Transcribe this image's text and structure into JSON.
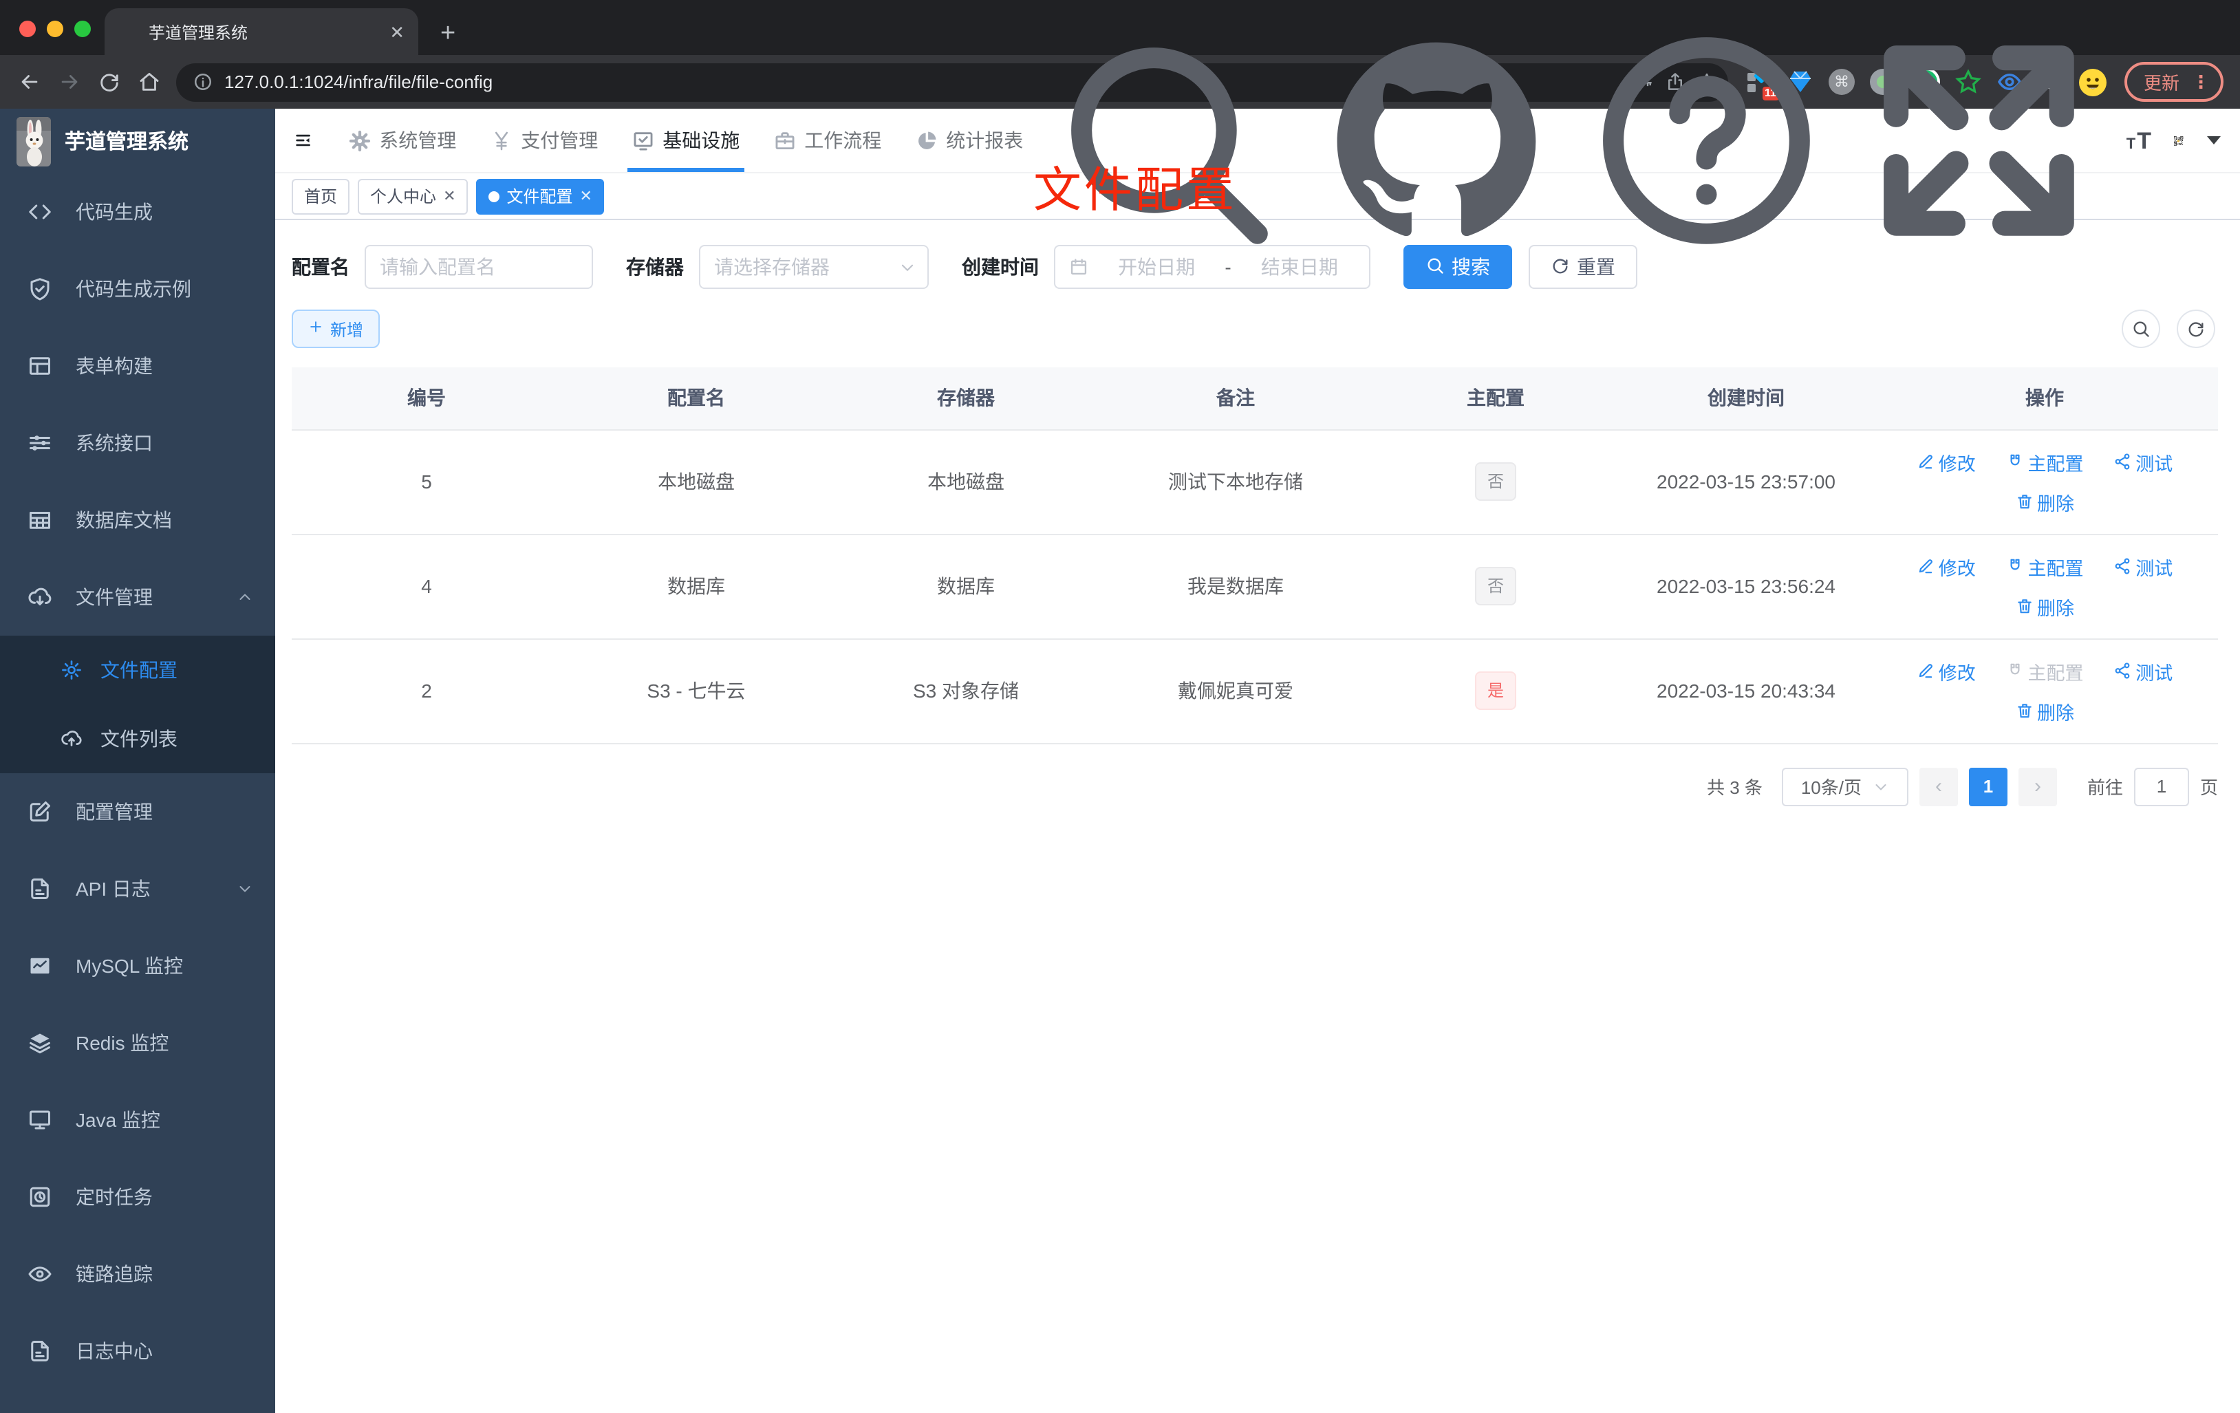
{
  "browser": {
    "tab_title": "芋道管理系统",
    "favicon": "sprout-icon",
    "url": "127.0.0.1:1024/infra/file/file-config",
    "url_left_icon": "info-icon",
    "url_right_icons": [
      "key-icon",
      "share-ios-icon",
      "star-icon"
    ],
    "nav_icons": [
      "back-icon",
      "forward-icon",
      "reload-icon",
      "home-icon"
    ],
    "extensions": [
      "tampermonkey-icon",
      "gem-icon",
      "cmd-circle-icon",
      "dot-circle-icon",
      "y-circle-icon",
      "green-star-icon",
      "blue-eye-icon",
      "puzzle-icon",
      "emoji-icon"
    ],
    "extension_badge": "11",
    "update_label": "更新"
  },
  "app": {
    "logo_title": "芋道管理系统",
    "accent_color": "#2d8cf0",
    "sidebar_color": "#304156"
  },
  "nav": {
    "items": [
      {
        "label": "系统管理",
        "icon": "gear-filled-icon",
        "active": false
      },
      {
        "label": "支付管理",
        "icon": "yen-icon",
        "active": false
      },
      {
        "label": "基础设施",
        "icon": "infra-icon",
        "active": true
      },
      {
        "label": "工作流程",
        "icon": "briefcase-icon",
        "active": false
      },
      {
        "label": "统计报表",
        "icon": "pie-icon",
        "active": false
      }
    ],
    "right_icons": [
      "search-icon",
      "github-icon",
      "question-icon",
      "fullscreen-icon",
      "fontsize-icon"
    ]
  },
  "sidebar": {
    "items": [
      {
        "label": "代码生成",
        "icon": "code-icon"
      },
      {
        "label": "代码生成示例",
        "icon": "shield-check-icon"
      },
      {
        "label": "表单构建",
        "icon": "form-icon"
      },
      {
        "label": "系统接口",
        "icon": "sliders-icon"
      },
      {
        "label": "数据库文档",
        "icon": "table-icon"
      },
      {
        "label": "文件管理",
        "icon": "cloud-download-icon",
        "expanded": true,
        "children": [
          {
            "label": "文件配置",
            "icon": "gear-icon",
            "active": true
          },
          {
            "label": "文件列表",
            "icon": "cloud-upload-icon",
            "active": false
          }
        ]
      },
      {
        "label": "配置管理",
        "icon": "edit-square-icon"
      },
      {
        "label": "API 日志",
        "icon": "log-icon",
        "collapsed": true
      },
      {
        "label": "MySQL 监控",
        "icon": "chart-icon"
      },
      {
        "label": "Redis 监控",
        "icon": "layers-icon"
      },
      {
        "label": "Java 监控",
        "icon": "monitor-icon"
      },
      {
        "label": "定时任务",
        "icon": "timer-icon"
      },
      {
        "label": "链路追踪",
        "icon": "eye-icon"
      },
      {
        "label": "日志中心",
        "icon": "log-icon"
      }
    ]
  },
  "tags": [
    {
      "label": "首页",
      "closable": false,
      "active": false
    },
    {
      "label": "个人中心",
      "closable": true,
      "active": false
    },
    {
      "label": "文件配置",
      "closable": true,
      "active": true
    }
  ],
  "annotation": "文件配置",
  "filters": {
    "name_label": "配置名",
    "name_placeholder": "请输入配置名",
    "storage_label": "存储器",
    "storage_placeholder": "请选择存储器",
    "date_label": "创建时间",
    "date_start_placeholder": "开始日期",
    "date_separator": "-",
    "date_end_placeholder": "结束日期",
    "search_label": "搜索",
    "reset_label": "重置",
    "add_label": "新增"
  },
  "table": {
    "columns": [
      "编号",
      "配置名",
      "存储器",
      "备注",
      "主配置",
      "创建时间",
      "操作"
    ],
    "rows": [
      {
        "id": "5",
        "name": "本地磁盘",
        "storage": "本地磁盘",
        "remark": "测试下本地存储",
        "master": "否",
        "master_type": "info",
        "created": "2022-03-15 23:57:00",
        "master_action_disabled": false
      },
      {
        "id": "4",
        "name": "数据库",
        "storage": "数据库",
        "remark": "我是数据库",
        "master": "否",
        "master_type": "info",
        "created": "2022-03-15 23:56:24",
        "master_action_disabled": false
      },
      {
        "id": "2",
        "name": "S3 - 七牛云",
        "storage": "S3 对象存储",
        "remark": "戴佩妮真可爱",
        "master": "是",
        "master_type": "danger",
        "created": "2022-03-15 20:43:34",
        "master_action_disabled": true
      }
    ],
    "actions": {
      "edit": "修改",
      "master": "主配置",
      "test": "测试",
      "delete": "删除"
    }
  },
  "pagination": {
    "total": "共 3 条",
    "page_size": "10条/页",
    "current_page": "1",
    "goto_label": "前往",
    "goto_value": "1",
    "page_suffix": "页"
  }
}
